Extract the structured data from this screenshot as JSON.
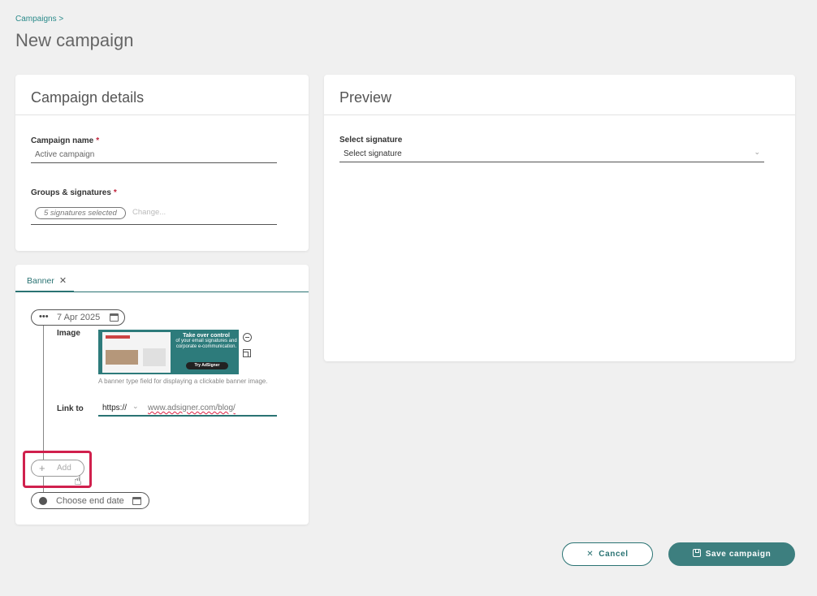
{
  "header": {
    "breadcrumb": "Campaigns >",
    "title": "New campaign"
  },
  "details_card": {
    "title": "Campaign details",
    "name_label": "Campaign name",
    "name_value": "Active campaign",
    "groups_label": "Groups & signatures",
    "chip_text": "5 signatures selected",
    "change_link": "Change...",
    "required_mark": "*"
  },
  "banner_card": {
    "tab_label": "Banner",
    "tab_close": "✕",
    "date_dots": "•••",
    "start_date": "7 Apr 2025",
    "image_label": "Image",
    "banner_headline": "Take over control",
    "banner_subtext": "of your email signatures and corporate e-communication.",
    "banner_cta": "Try AdSigner",
    "help_text": "A banner type field for displaying a clickable banner image.",
    "link_label": "Link to",
    "protocol": "https://",
    "url_value": "www.adsigner.com/blog/",
    "add_label": "Add",
    "add_plus": "+",
    "end_date_label": "Choose end date"
  },
  "preview_card": {
    "title": "Preview",
    "signature_label": "Select signature",
    "signature_value": "Select signature"
  },
  "footer": {
    "cancel_icon": "✕",
    "cancel_label": "Cancel",
    "save_label": "Save campaign"
  },
  "icons": {
    "chevron": "⌄",
    "cursor": "☝"
  },
  "colors": {
    "accent": "#2a7373",
    "highlight": "#d0204d",
    "required": "#c0223b",
    "save_button": "#3d7f7f"
  }
}
